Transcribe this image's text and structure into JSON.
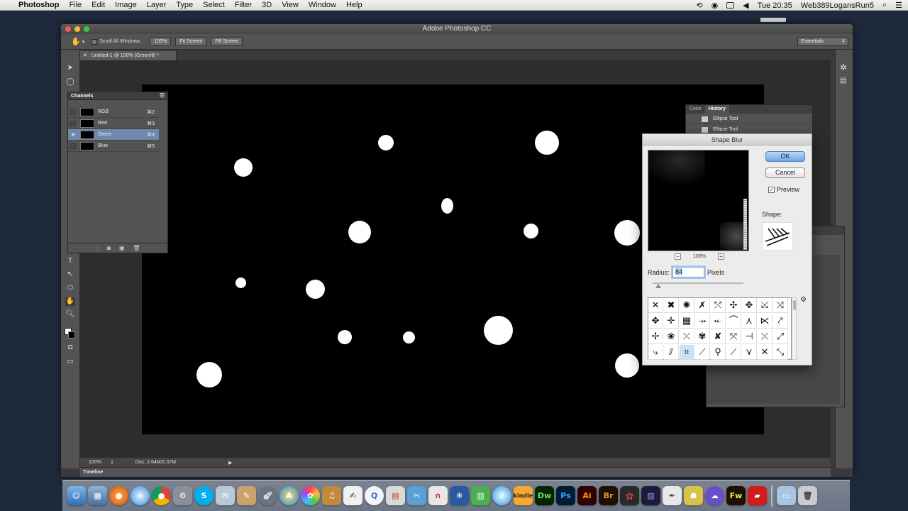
{
  "menubar": {
    "app_name": "Photoshop",
    "items": [
      "File",
      "Edit",
      "Image",
      "Layer",
      "Type",
      "Select",
      "Filter",
      "3D",
      "View",
      "Window",
      "Help"
    ],
    "clock": "Tue 20:35",
    "user": "Web389LogansRun5"
  },
  "window": {
    "title": "Adobe Photoshop CC",
    "options": {
      "scroll_all": "Scroll All Windows",
      "zoom_100": "100%",
      "fit_screen": "Fit Screen",
      "fill_screen": "Fill Screen",
      "workspace": "Essentials"
    },
    "doc_tab": "Untitled-1 @ 100% (Green/8) *",
    "status": {
      "zoom": "100%",
      "doc": "Doc: 2.64M/2.37M"
    },
    "timeline": "Timeline"
  },
  "channels": {
    "title": "Channels",
    "rows": [
      {
        "name": "RGB",
        "shortcut": "⌘2",
        "visible": false
      },
      {
        "name": "Red",
        "shortcut": "⌘3",
        "visible": false
      },
      {
        "name": "Green",
        "shortcut": "⌘4",
        "visible": true,
        "selected": true
      },
      {
        "name": "Blue",
        "shortcut": "⌘5",
        "visible": false
      }
    ]
  },
  "history": {
    "tabs": [
      "Color",
      "History"
    ],
    "active_tab": "History",
    "items": [
      "Ellipse Tool",
      "Ellipse Tool"
    ]
  },
  "dialog": {
    "title": "Shape Blur",
    "ok": "OK",
    "cancel": "Cancel",
    "preview_label": "Preview",
    "preview_checked": true,
    "shape_label": "Shape:",
    "zoom": "100%",
    "radius_label": "Radius:",
    "radius_value": "84",
    "units": "Pixels",
    "radius_slider_fraction": 0.07,
    "selected_shape_index": 29
  },
  "colors": {
    "accent": "#4d83c5",
    "panel_bg": "#535353",
    "canvas_bg": "#000000"
  }
}
